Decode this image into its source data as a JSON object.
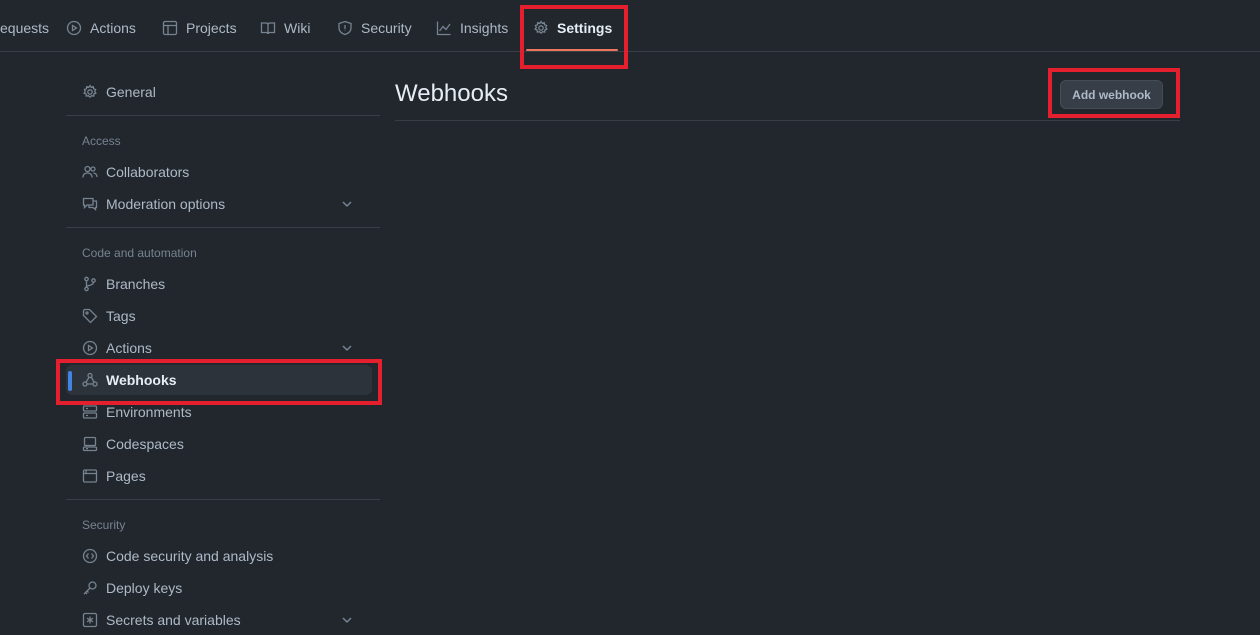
{
  "topnav": {
    "tabs": [
      {
        "label": "equests",
        "icon": "pull-request-icon"
      },
      {
        "label": "Actions",
        "icon": "play-icon"
      },
      {
        "label": "Projects",
        "icon": "table-icon"
      },
      {
        "label": "Wiki",
        "icon": "book-icon"
      },
      {
        "label": "Security",
        "icon": "shield-icon"
      },
      {
        "label": "Insights",
        "icon": "graph-icon"
      },
      {
        "label": "Settings",
        "icon": "gear-icon",
        "selected": true
      }
    ]
  },
  "sidebar": {
    "general": "General",
    "sections": [
      {
        "heading": "Access",
        "items": [
          {
            "label": "Collaborators",
            "icon": "people-icon"
          },
          {
            "label": "Moderation options",
            "icon": "comment-icon",
            "expandable": true
          }
        ]
      },
      {
        "heading": "Code and automation",
        "items": [
          {
            "label": "Branches",
            "icon": "branch-icon"
          },
          {
            "label": "Tags",
            "icon": "tag-icon"
          },
          {
            "label": "Actions",
            "icon": "play-icon",
            "expandable": true
          },
          {
            "label": "Webhooks",
            "icon": "webhook-icon",
            "active": true
          },
          {
            "label": "Environments",
            "icon": "server-icon"
          },
          {
            "label": "Codespaces",
            "icon": "codespaces-icon"
          },
          {
            "label": "Pages",
            "icon": "browser-icon"
          }
        ]
      },
      {
        "heading": "Security",
        "items": [
          {
            "label": "Code security and analysis",
            "icon": "codescan-icon"
          },
          {
            "label": "Deploy keys",
            "icon": "key-icon"
          },
          {
            "label": "Secrets and variables",
            "icon": "asterisk-icon",
            "expandable": true
          }
        ]
      }
    ]
  },
  "main": {
    "title": "Webhooks",
    "add_button": "Add webhook"
  },
  "colors": {
    "background": "#22272e",
    "active_bar": "#4184e4",
    "tab_underline": "#ec775c",
    "highlight": "#e5202e"
  }
}
